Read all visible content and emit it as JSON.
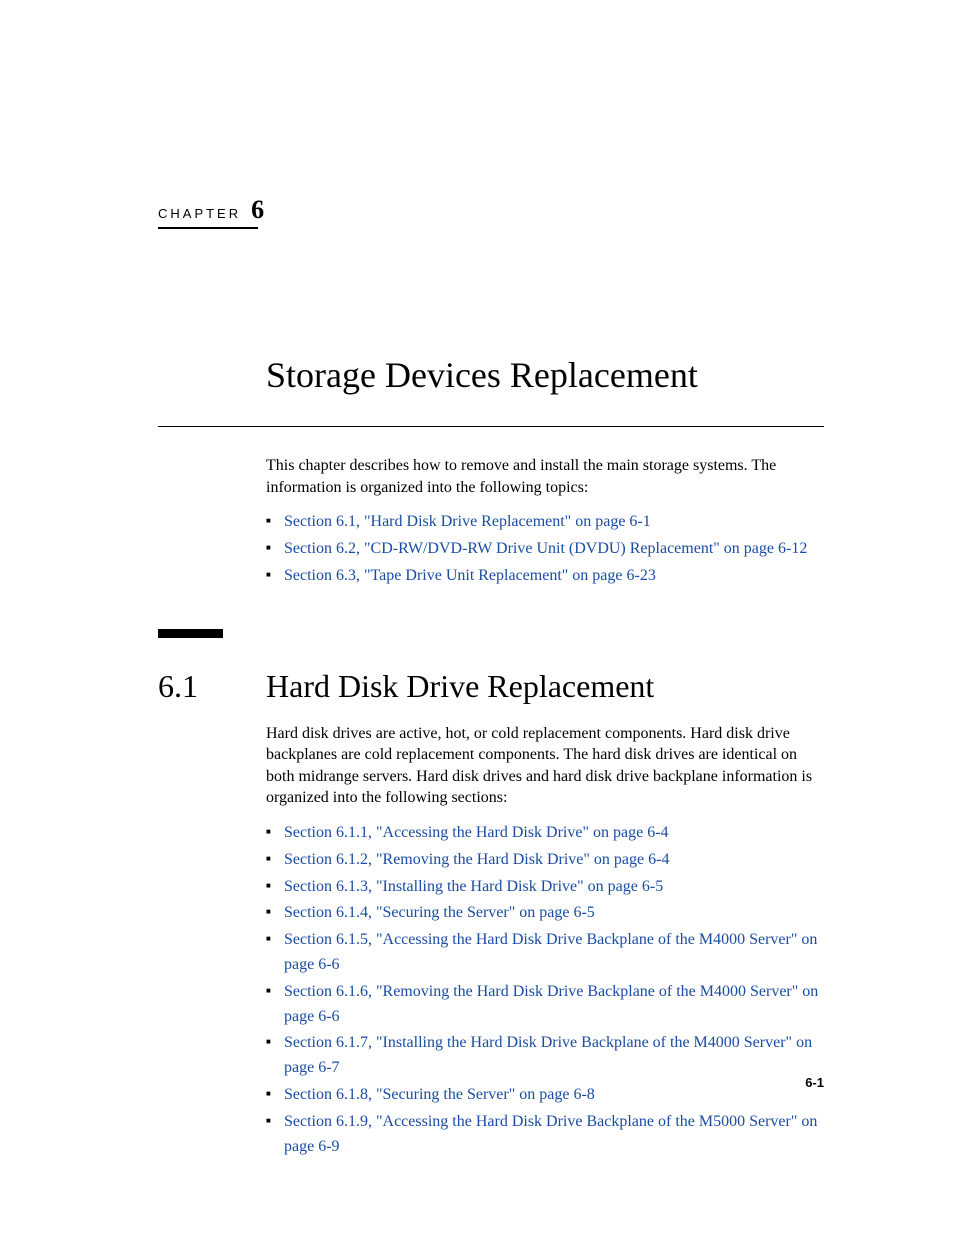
{
  "chapter": {
    "label": "CHAPTER",
    "number": "6",
    "title": "Storage Devices Replacement"
  },
  "intro": "This chapter describes how to remove and install the main storage systems. The information is organized into the following topics:",
  "topLinks": [
    "Section 6.1, \"Hard Disk Drive Replacement\" on page 6-1",
    "Section 6.2, \"CD-RW/DVD-RW Drive Unit (DVDU) Replacement\" on page 6-12",
    "Section 6.3, \"Tape Drive Unit Replacement\" on page 6-23"
  ],
  "section": {
    "number": "6.1",
    "title": "Hard Disk Drive Replacement",
    "intro": "Hard disk drives are active, hot, or cold replacement components. Hard disk drive backplanes are cold replacement components. The hard disk drives are identical on both midrange servers. Hard disk drives and hard disk drive backplane information is organized into the following sections:",
    "links": [
      "Section 6.1.1, \"Accessing the Hard Disk Drive\" on page 6-4",
      "Section 6.1.2, \"Removing the Hard Disk Drive\" on page 6-4",
      "Section 6.1.3, \"Installing the Hard Disk Drive\" on page 6-5",
      "Section 6.1.4, \"Securing the Server\" on page 6-5",
      "Section 6.1.5, \"Accessing the Hard Disk Drive Backplane of the M4000 Server\" on page 6-6",
      "Section 6.1.6, \"Removing the Hard Disk Drive Backplane of the M4000 Server\" on page 6-6",
      "Section 6.1.7, \"Installing the Hard Disk Drive Backplane of the M4000 Server\" on page 6-7",
      "Section 6.1.8, \"Securing the Server\" on page 6-8",
      "Section 6.1.9, \"Accessing the Hard Disk Drive Backplane of the M5000 Server\" on page 6-9"
    ]
  },
  "pageNumber": "6-1"
}
